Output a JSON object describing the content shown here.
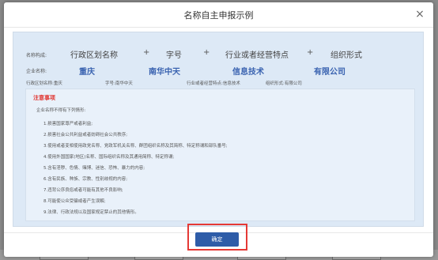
{
  "dialog": {
    "title": "名称自主申报示例",
    "close_symbol": "×",
    "confirm_label": "确定"
  },
  "structure": {
    "label": "名称构成:",
    "parts": [
      "行政区划名称",
      "字号",
      "行业或者经营特点",
      "组织形式"
    ],
    "plus": "+"
  },
  "example": {
    "label": "企业名称:",
    "values": [
      "重庆",
      "南华中天",
      "信息技术",
      "有限公司"
    ]
  },
  "details": [
    "行政区划名称:重庆",
    "字号:南华中天",
    "行业或者经营特点:信息技术",
    "组织形式:有限公司"
  ],
  "notice": {
    "title": "注意事项",
    "intro": "企业名称不得有下列情形:",
    "items": [
      "1.损害国家尊严或者利益;",
      "2.损害社会公共利益或者妨碍社会公共秩序;",
      "3.使用或者变相使用政党名称、党政军机关名称、群团组织名称及其简称、特定称谓和部队番号;",
      "4.使用外国国家(地区)名称、国际组织名称及其通用简称、特定称谓;",
      "5.含有淫秽、色情、赌博、迷信、恐怖、暴力的内容;",
      "6.含有民族、种族、宗教、性别歧视的内容;",
      "7.违背公序良俗或者可能有其他不良影响;",
      "8.可能使公众受骗或者产生误解;",
      "9.法律、行政法规以及国家规定禁止的其他情形。"
    ]
  }
}
